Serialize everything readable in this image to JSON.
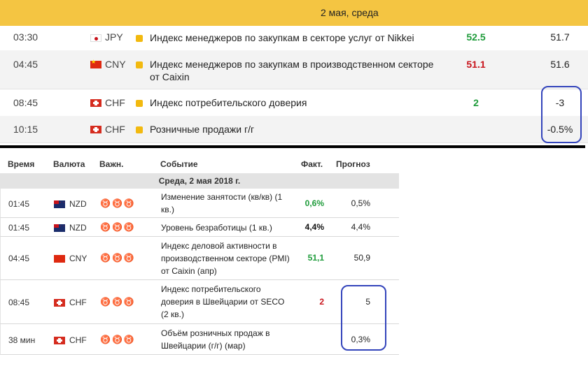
{
  "top_calendar": {
    "date_header": "2 мая, среда",
    "rows": [
      {
        "time": "03:30",
        "currency": "JPY",
        "flag": "japan-flag",
        "event": "Индекс менеджеров по закупкам в секторе услуг от Nikkei",
        "actual": "52.5",
        "actual_color": "#1e9b3a",
        "forecast": "51.7"
      },
      {
        "time": "04:45",
        "currency": "CNY",
        "flag": "china-flag",
        "event": "Индекс менеджеров по закупкам в производственном секторе от Caixin",
        "actual": "51.1",
        "actual_color": "#c8131b",
        "forecast": "51.6"
      },
      {
        "time": "08:45",
        "currency": "CHF",
        "flag": "switzerland-flag",
        "event": "Индекс потребительского доверия",
        "actual": "2",
        "actual_color": "#1e9b3a",
        "forecast": "-3"
      },
      {
        "time": "10:15",
        "currency": "CHF",
        "flag": "switzerland-flag",
        "event": "Розничные продажи г/г",
        "actual": "",
        "forecast": "-0.5%"
      }
    ]
  },
  "bottom_calendar": {
    "headers": {
      "time": "Время",
      "currency": "Валюта",
      "importance": "Важн.",
      "event": "Событие",
      "actual": "Факт.",
      "forecast": "Прогноз"
    },
    "date_row": "Среда, 2 мая 2018 г.",
    "rows": [
      {
        "time": "01:45",
        "currency": "NZD",
        "flag": "new-zealand-flag",
        "importance": 3,
        "event": "Изменение занятости (кв/кв) (1 кв.)",
        "actual": "0,6%",
        "actual_color": "#1e9b3a",
        "forecast": "0,5%"
      },
      {
        "time": "01:45",
        "currency": "NZD",
        "flag": "new-zealand-flag",
        "importance": 2,
        "event": "Уровень безработицы (1 кв.)",
        "actual": "4,4%",
        "actual_color": "#111111",
        "forecast": "4,4%"
      },
      {
        "time": "04:45",
        "currency": "CNY",
        "flag": "china-flag",
        "importance": 3,
        "event": "Индекс деловой активности в производственном секторе (PMI) от Caixin (апр)",
        "actual": "51,1",
        "actual_color": "#1e9b3a",
        "forecast": "50,9"
      },
      {
        "time": "08:45",
        "currency": "CHF",
        "flag": "switzerland-flag",
        "importance": 2,
        "event": "Индекс потребительского доверия в Швейцарии от SECO (2 кв.)",
        "actual": "2",
        "actual_color": "#c8131b",
        "forecast": "5"
      },
      {
        "time": "38 мин",
        "currency": "CHF",
        "flag": "switzerland-flag",
        "importance": 2,
        "event": "Объём розничных продаж в Швейцарии (г/г) (мар)",
        "actual": "",
        "forecast": "0,3%"
      }
    ]
  },
  "colors": {
    "header_yellow": "#f4c542",
    "annotation_blue": "#3344bb"
  }
}
